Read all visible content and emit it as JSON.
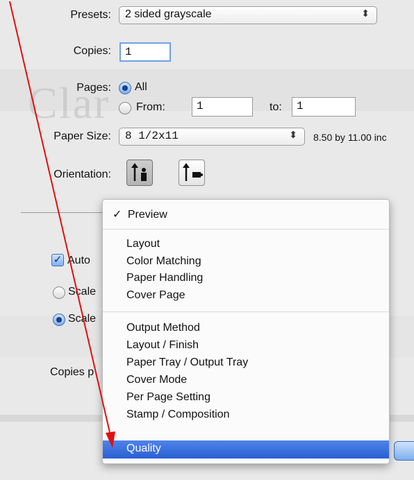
{
  "presets": {
    "label": "Presets:",
    "value": "2 sided grayscale"
  },
  "copies": {
    "label": "Copies:",
    "value": "1"
  },
  "pages": {
    "label": "Pages:",
    "all_label": "All",
    "from_label": "From:",
    "from_value": "1",
    "to_label": "to:",
    "to_value": "1",
    "selected": "All"
  },
  "paper_size": {
    "label": "Paper Size:",
    "value": "8 1/2x11",
    "dimensions": "8.50 by 11.00 inc"
  },
  "orientation": {
    "label": "Orientation:",
    "selected": "portrait"
  },
  "behind_menu": {
    "auto_label": "Auto",
    "scale_label_1": "Scale",
    "scale_label_2": "Scale",
    "copies_per_label": "Copies p",
    "ghost_text": "Clar"
  },
  "popup_menu": {
    "checked_item": "Preview",
    "items": [
      "Layout",
      "Color Matching",
      "Paper Handling",
      "Cover Page",
      "Output Method",
      "Layout / Finish",
      "Paper Tray / Output Tray",
      "Cover Mode",
      "Per Page Setting",
      "Stamp / Composition"
    ],
    "highlighted_item": "Quality"
  },
  "icons": {
    "check": "checkmark-icon",
    "arrow": "red-annotation-arrow",
    "popup_arrows": "updown-arrows-icon"
  },
  "colors": {
    "highlight": "#2a5fd4",
    "annotation": "#e01010"
  }
}
